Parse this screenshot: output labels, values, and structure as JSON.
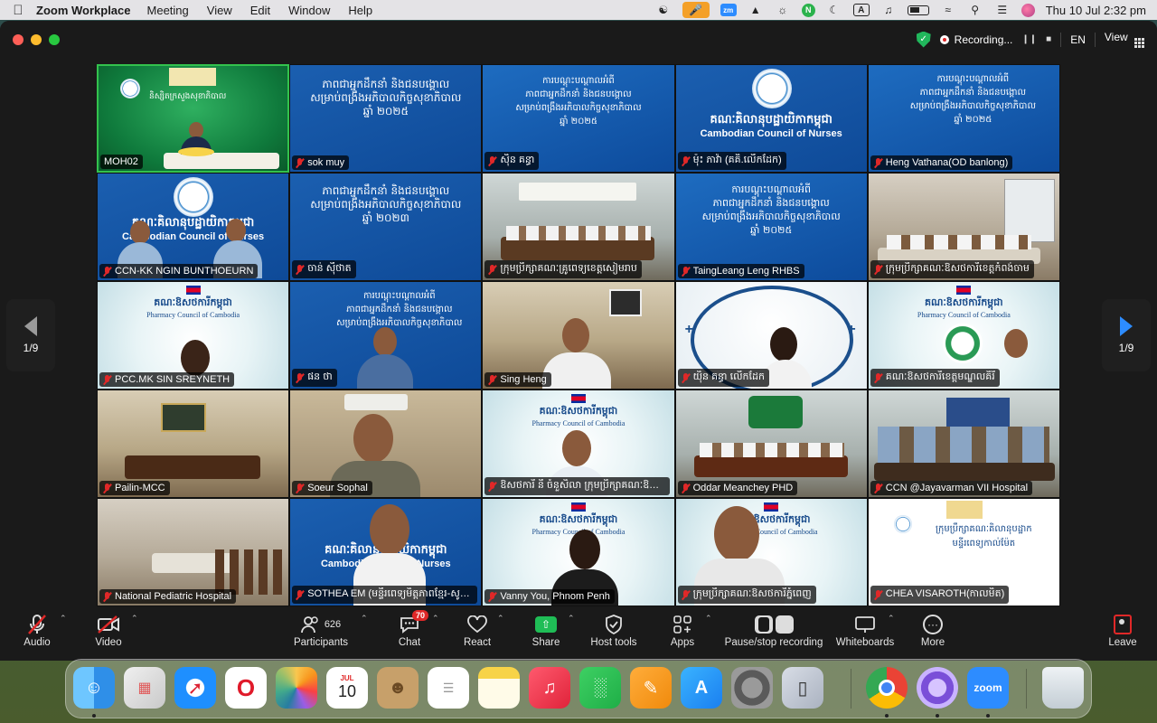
{
  "menubar": {
    "app_name": "Zoom Workplace",
    "menus": [
      "Meeting",
      "View",
      "Edit",
      "Window",
      "Help"
    ],
    "clock": "Thu 10 Jul  2:32 pm",
    "zoom_icon_text": "zm",
    "input_badge": "A"
  },
  "titlebar": {
    "recording_label": "Recording...",
    "language": "EN",
    "view_label": "View"
  },
  "pagination": {
    "left_label": "1/9",
    "right_label": "1/9"
  },
  "participants": [
    {
      "name": "MOH02",
      "muted": false,
      "active": true
    },
    {
      "name": "sok muy",
      "muted": true
    },
    {
      "name": "ស៊ិន គន្ធា",
      "muted": true
    },
    {
      "name": "ម៉ុះ ភាវ៉ា (គគិ.លើកដែក)",
      "muted": true
    },
    {
      "name": "Heng Vathana(OD banlong)",
      "muted": true
    },
    {
      "name": "CCN-KK NGIN BUNTHOEURN",
      "muted": true
    },
    {
      "name": "ចាន់ ស៊ីថាត",
      "muted": true
    },
    {
      "name": "ក្រុមប្រឹក្សាគណៈគ្រូពេទ្យខេត្តសៀមរាប",
      "muted": true
    },
    {
      "name": "TaingLeang Leng RHBS",
      "muted": true
    },
    {
      "name": "ក្រុមប្រឹក្សាគណៈឱសថការីខេត្តកំពង់ចាម",
      "muted": true
    },
    {
      "name": "PCC.MK SIN SREYNETH",
      "muted": true
    },
    {
      "name": "ផន ថា",
      "muted": true
    },
    {
      "name": "Sing Heng",
      "muted": true
    },
    {
      "name": "យ៉ិន គន្ធា លើកដែក",
      "muted": true
    },
    {
      "name": "គណៈឱសថការីខេត្តមណ្ឌលគិរី",
      "muted": true
    },
    {
      "name": "Pailin-MCC",
      "muted": true
    },
    {
      "name": "Soeur Sophal",
      "muted": true
    },
    {
      "name": "ឱសថការី នី ចំនួសិលា ក្រុមប្រឹក្សាគណៈឱសថ...",
      "muted": true
    },
    {
      "name": "Oddar Meanchey PHD",
      "muted": true
    },
    {
      "name": "CCN @Jayavarman VII Hospital",
      "muted": true
    },
    {
      "name": "National Pediatric Hospital",
      "muted": true
    },
    {
      "name": "SOTHEA EM (មន្ទីរពេទ្យមិត្តភាពខ្មែរ-សូវៀត)",
      "muted": true
    },
    {
      "name": "Vanny You, Phnom Penh",
      "muted": true
    },
    {
      "name": "ក្រុមប្រឹក្សាគណៈឱសថការីភ្នំពេញ",
      "muted": true
    },
    {
      "name": "CHEA VISAROTH(កាលមិត)",
      "muted": true
    }
  ],
  "slides": {
    "moh_header": "និស្សិតក្រសួងសុខាភិបាល",
    "leadership_title": [
      "ភាពជាអ្នកដឹកនាំ និងជនបង្គោល",
      "សម្រាប់ពង្រឹងអភិបាលកិច្ចសុខាភិបាល",
      "ឆ្នាំ ២០២៥"
    ],
    "leadership_title_2023": [
      "ភាពជាអ្នកដឹកនាំ និងជនបង្គោល",
      "សម្រាប់ពង្រឹងអភិបាលកិច្ចសុខាភិបាល",
      "ឆ្នាំ ២០២៣"
    ],
    "ccn_khmer": "គណៈគិលានុបដ្ឋាយិកាកម្ពុជា",
    "ccn_english": "Cambodian Council of Nurses",
    "ccn_partial": "Cambodian Council  Nurses",
    "pharm_khmer": "គណៈឱសថការីកម្ពុជា",
    "pharm_english": "Pharmacy Council of Cambodia",
    "training_header": "ការបណ្តុះបណ្តាលអំពី",
    "chea_slide": [
      "ក្រុមប្រឹក្សាគណៈគិលានុបដ្ឋាក",
      "មន្ទីរពេទ្យកាល់ម៉ែត"
    ]
  },
  "toolbar": {
    "audio_label": "Audio",
    "video_label": "Video",
    "participants_label": "Participants",
    "participants_count": "626",
    "chat_label": "Chat",
    "chat_badge": "70",
    "react_label": "React",
    "share_label": "Share",
    "host_tools_label": "Host tools",
    "apps_label": "Apps",
    "recording_label": "Pause/stop recording",
    "whiteboards_label": "Whiteboards",
    "more_label": "More",
    "leave_label": "Leave"
  },
  "dock": {
    "calendar_month": "JUL",
    "calendar_day": "10",
    "zoom_label": "zoom",
    "apps": [
      "finder",
      "launchpad",
      "safari",
      "opera",
      "photos",
      "calendar",
      "contacts",
      "reminders",
      "notes",
      "music",
      "numbers",
      "pages",
      "app-store",
      "system-settings",
      "iphone-mirroring",
      "chrome",
      "tor",
      "zoom",
      "trash"
    ]
  },
  "colors": {
    "zoom_blue": "#2d8cff",
    "active_speaker_green": "#33c24d",
    "muted_red": "#e02828",
    "share_green": "#1fbd56"
  }
}
